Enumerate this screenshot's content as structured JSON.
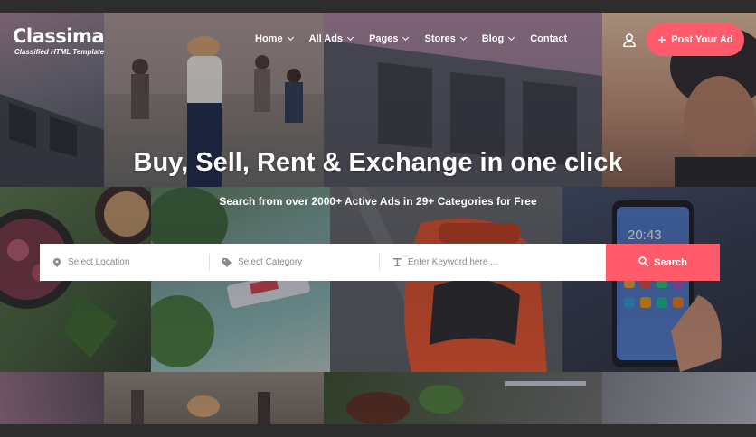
{
  "brand": {
    "name": "Classima",
    "tagline": "Classified HTML Template",
    "accent": "#ff5b6a"
  },
  "nav": {
    "items": [
      {
        "label": "Home",
        "has_dropdown": true
      },
      {
        "label": "All Ads",
        "has_dropdown": true
      },
      {
        "label": "Pages",
        "has_dropdown": true
      },
      {
        "label": "Stores",
        "has_dropdown": true
      },
      {
        "label": "Blog",
        "has_dropdown": true
      },
      {
        "label": "Contact",
        "has_dropdown": false
      }
    ],
    "account_icon": "user-icon",
    "post_button": {
      "label": "Post Your Ad",
      "icon": "plus-icon"
    }
  },
  "hero": {
    "headline": "Buy, Sell, Rent & Exchange in one click",
    "subheadline": "Search from over 2000+ Active Ads in 29+ Categories for Free"
  },
  "search": {
    "location_placeholder": "Select Location",
    "category_placeholder": "Select Category",
    "keyword_placeholder": "Enter Keyword here ...",
    "button_label": "Search",
    "location_icon": "map-pin-icon",
    "category_icon": "tag-icon",
    "keyword_icon": "text-icon",
    "button_icon": "search-icon"
  }
}
